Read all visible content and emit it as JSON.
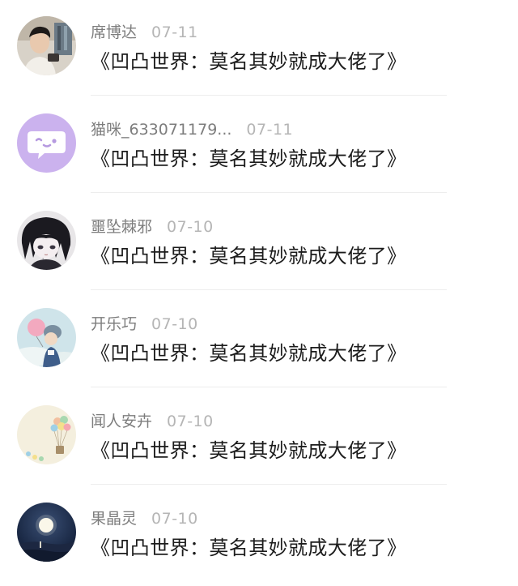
{
  "comments": [
    {
      "name": "席博达",
      "date": "07-11",
      "text": "《凹凸世界：莫名其妙就成大佬了》",
      "avatar": "photo-avatar"
    },
    {
      "name": "猫咪_633071179...",
      "date": "07-11",
      "text": "《凹凸世界：莫名其妙就成大佬了》",
      "avatar": "default-chat-avatar"
    },
    {
      "name": "噩坠棘邪",
      "date": "07-10",
      "text": "《凹凸世界：莫名其妙就成大佬了》",
      "avatar": "anime-avatar"
    },
    {
      "name": "开乐巧",
      "date": "07-10",
      "text": "《凹凸世界：莫名其妙就成大佬了》",
      "avatar": "balloon-character-avatar"
    },
    {
      "name": "闻人安卉",
      "date": "07-10",
      "text": "《凹凸世界：莫名其妙就成大佬了》",
      "avatar": "balloons-avatar"
    },
    {
      "name": "果晶灵",
      "date": "07-10",
      "text": "《凹凸世界：莫名其妙就成大佬了》",
      "avatar": "moon-night-avatar"
    }
  ],
  "colors": {
    "default_avatar_bg": "#cbb2ee",
    "name_text": "#7d7d7d",
    "date_text": "#b5b5b5",
    "body_text": "#1c1c1c"
  }
}
